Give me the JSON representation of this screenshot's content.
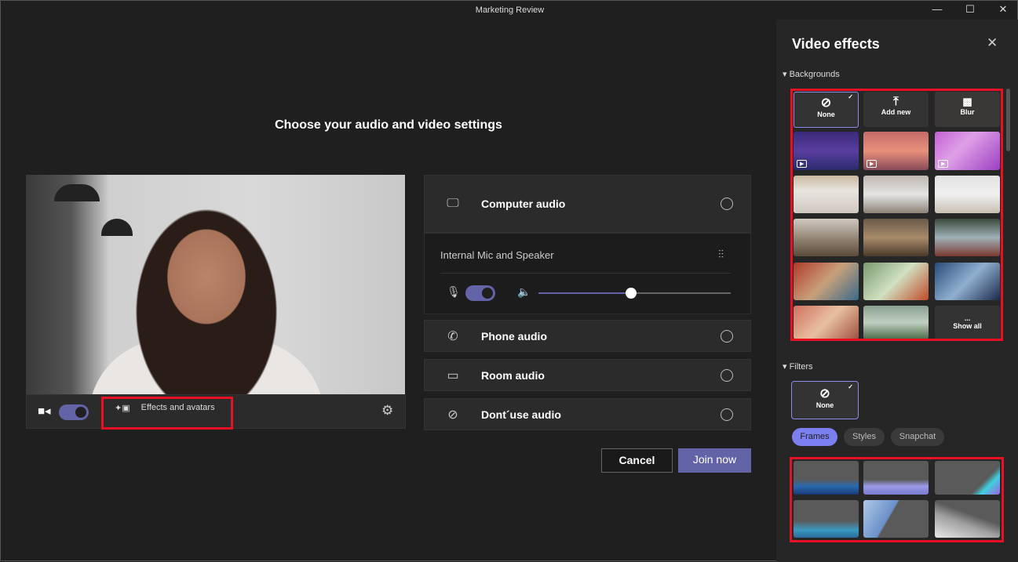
{
  "window": {
    "title": "Marketing Review",
    "minimize": "—",
    "maximize": "☐",
    "close": "✕"
  },
  "main": {
    "heading": "Choose your audio and video settings"
  },
  "video_bar": {
    "effects_label": "Effects and avatars",
    "camera_on": true
  },
  "audio": {
    "options": [
      {
        "label": "Computer audio",
        "icon": "computer-audio-icon",
        "glyph": "🖵"
      },
      {
        "label": "Phone audio",
        "icon": "phone-audio-icon",
        "glyph": "✆"
      },
      {
        "label": "Room audio",
        "icon": "room-audio-icon",
        "glyph": "▭"
      },
      {
        "label": "Dont´use audio",
        "icon": "no-audio-icon",
        "glyph": "⊘"
      }
    ],
    "device": "Internal Mic and Speaker",
    "mic_on": true,
    "volume_percent": 48
  },
  "actions": {
    "cancel": "Cancel",
    "join": "Join now"
  },
  "colors": {
    "accent": "#6264a7",
    "chip_active": "#7b7ff0",
    "highlight": "#e81123"
  },
  "effects": {
    "title": "Video effects",
    "close": "✕",
    "backgrounds_label": "Backgrounds",
    "bg_none": "None",
    "bg_add": "Add new",
    "bg_blur": "Blur",
    "show_all": "Show all",
    "more": "...",
    "bg_tiles": [
      "linear-gradient(180deg,#3b2a7a,#5a3e9e 50%,#2a2a6e)",
      "linear-gradient(180deg,#c56a6a,#e8907a 50%,#8a4a5a)",
      "linear-gradient(135deg,#c060d0,#e0a0e8 40%,#9a40c0)",
      "linear-gradient(180deg,#c9b8a0,#e8e4de 40%,#cfc8c0)",
      "linear-gradient(180deg,#bdb7ae,#e4e4e4 50%,#8a8378)",
      "linear-gradient(180deg,#e2e2e2,#f0f0f0 50%,#c8bfb2)",
      "linear-gradient(180deg,#cfc9c0,#8a7b6a 60%,#5a4a3a)",
      "linear-gradient(180deg,#6a5a48,#a88a6a 50%,#4a3a2a)",
      "linear-gradient(180deg,#3a4a3a,#a0b0b8 50%,#7a3a30)",
      "linear-gradient(135deg,#b03a2a,#c8a07a 50%,#3a6a8a)",
      "linear-gradient(135deg,#7a9a70,#d0e0c0 50%,#c04a2a)",
      "linear-gradient(135deg,#2a4a7a,#90b0d0 50%,#1a2a4a)",
      "linear-gradient(135deg,#d07060,#e8c0a0 50%,#a05040)",
      "linear-gradient(180deg,#8aa090,#c0d0c0 50%,#4a6a4a)"
    ],
    "filters_label": "Filters",
    "filter_none": "None",
    "chips": [
      "Frames",
      "Styles",
      "Snapchat"
    ],
    "frame_tiles": [
      "linear-gradient(180deg,#5a5a5a 55%,#2a6ab0 75%,#1a3a7a)",
      "linear-gradient(180deg,#5a5a5a 55%,#9a9ae8 75%,#7a7ad0)",
      "linear-gradient(135deg,#5a5a5a 70%,#40d0e0 80%,#a060e0)",
      "linear-gradient(180deg,#5a5a5a 55%,#3a9ac0 80%,#2a6a9a)",
      "linear-gradient(120deg,#b0c8e8,#6a90c8 40%,#5a5a5a 42%)",
      "linear-gradient(200deg,#5a5a5a 40%,#a0a0a0 60%,#e8e8e8)"
    ]
  }
}
